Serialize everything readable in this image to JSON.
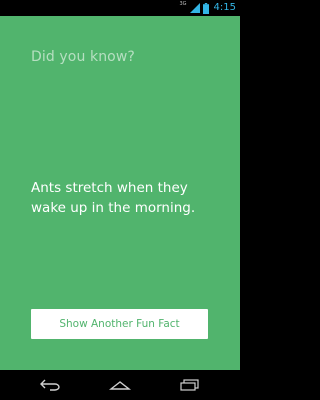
{
  "status_bar": {
    "network_label": "3G",
    "time": "4:15",
    "accent_color": "#33b5e5"
  },
  "main": {
    "intro_label": "Did you know?",
    "fact_text": "Ants stretch when they wake up in the morning.",
    "button_label": "Show Another Fun Fact",
    "background_color": "#51b46d"
  },
  "nav_bar": {
    "icons": [
      "back-icon",
      "home-icon",
      "recent-apps-icon"
    ]
  }
}
